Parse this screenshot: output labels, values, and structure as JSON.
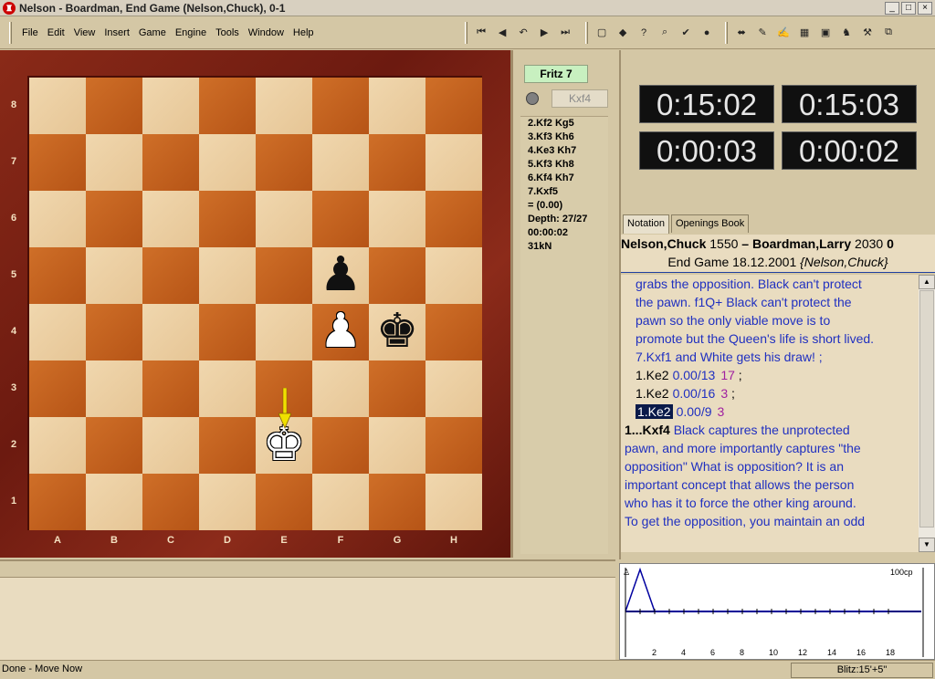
{
  "window": {
    "title": "Nelson - Boardman, End Game  (Nelson,Chuck), 0-1",
    "controls": [
      "_",
      "□",
      "×"
    ]
  },
  "menu": [
    "File",
    "Edit",
    "View",
    "Insert",
    "Game",
    "Engine",
    "Tools",
    "Window",
    "Help"
  ],
  "toolbar": {
    "nav": [
      {
        "icon": "first-move-icon",
        "glyph": "⏮"
      },
      {
        "icon": "prev-move-icon",
        "glyph": "◀"
      },
      {
        "icon": "takeback-icon",
        "glyph": "↶"
      },
      {
        "icon": "next-move-icon",
        "glyph": "▶"
      },
      {
        "icon": "last-move-icon",
        "glyph": "⏭"
      }
    ],
    "tools": [
      {
        "icon": "new-game-icon",
        "glyph": "▢"
      },
      {
        "icon": "hint-icon",
        "glyph": "◆"
      },
      {
        "icon": "question-icon",
        "glyph": "?"
      },
      {
        "icon": "analyze-icon",
        "glyph": "⌕"
      },
      {
        "icon": "ok-icon",
        "glyph": "✔"
      },
      {
        "icon": "stop-icon",
        "glyph": "●"
      }
    ],
    "tools2": [
      {
        "icon": "flip-board-icon",
        "glyph": "⬌"
      },
      {
        "icon": "brush-icon",
        "glyph": "✎"
      },
      {
        "icon": "pen-icon",
        "glyph": "✍"
      },
      {
        "icon": "grid-icon",
        "glyph": "▦"
      },
      {
        "icon": "window-icon",
        "glyph": "▣"
      },
      {
        "icon": "knight-icon",
        "glyph": "♞"
      },
      {
        "icon": "wrench-icon",
        "glyph": "⚒"
      },
      {
        "icon": "windows-icon",
        "glyph": "⧉"
      }
    ]
  },
  "board": {
    "ranks": [
      "8",
      "7",
      "6",
      "5",
      "4",
      "3",
      "2",
      "1"
    ],
    "files": [
      "A",
      "B",
      "C",
      "D",
      "E",
      "F",
      "G",
      "H"
    ],
    "pieces": [
      {
        "square": "f5",
        "glyph": "♟",
        "color": "black",
        "name": "black-pawn-f5"
      },
      {
        "square": "f4",
        "glyph": "♟",
        "color": "white",
        "name": "white-pawn-f4"
      },
      {
        "square": "g4",
        "glyph": "♚",
        "color": "black",
        "name": "black-king-g4"
      },
      {
        "square": "e2",
        "glyph": "♚",
        "color": "white",
        "name": "white-king-e2"
      }
    ]
  },
  "engine": {
    "name": "Fritz 7",
    "current_move": "Kxf4",
    "lines": [
      "2.Kf2 Kg5",
      "3.Kf3 Kh6",
      "4.Ke3 Kh7",
      "5.Kf3 Kh8",
      "6.Kf4 Kh7",
      "7.Kxf5",
      "=  (0.00)",
      "Depth: 27/27",
      "00:00:02",
      "31kN"
    ]
  },
  "clocks": [
    "0:15:02",
    "0:15:03",
    "0:00:03",
    "0:00:02"
  ],
  "notation": {
    "tabs": [
      "Notation",
      "Openings Book"
    ],
    "white_player": "Nelson,Chuck",
    "white_elo": "1550",
    "separator": "–",
    "black_player": "Boardman,Larry",
    "black_elo": "2030",
    "result_partial": "0",
    "event_line": "End Game 18.12.2001",
    "annotator": "{Nelson,Chuck}",
    "comment_lines": [
      "grabs the opposition.  Black can't protect",
      "the pawn.  f1Q+ Black can't protect the",
      "pawn so the only viable move is to",
      "promote but the Queen's life is short lived.",
      "7.Kxf1 and White gets his draw! ;"
    ],
    "variations": [
      {
        "move": "1.Ke2",
        "eval": "0.00/13",
        "num": "17",
        "tail": " ;",
        "selected": false
      },
      {
        "move": "1.Ke2",
        "eval": "0.00/16",
        "num": "3",
        "tail": " ;",
        "selected": false
      },
      {
        "move": "1.Ke2",
        "eval": "0.00/9",
        "num": "3",
        "tail": "",
        "selected": true
      }
    ],
    "main_move": "1...Kxf4",
    "main_lines": [
      " Black captures the unprotected",
      "pawn, and more importantly captures \"the",
      "opposition\"  What is opposition?  It is an",
      "important concept that allows the person",
      "who has it to force the other king around.",
      "To get the opposition, you  maintain an odd"
    ]
  },
  "eval_graph": {
    "max_label": "100cp",
    "x_labels": [
      "2",
      "4",
      "6",
      "8",
      "10",
      "12",
      "14",
      "16",
      "18"
    ],
    "values": [
      0,
      100,
      0,
      0,
      0,
      0,
      0,
      0,
      0,
      0,
      0,
      0,
      0,
      0,
      0,
      0,
      0,
      0,
      0
    ]
  },
  "status": {
    "left": "Done - Move Now",
    "right": "Blitz:15'+5\""
  },
  "colors": {
    "light_square": "#ebcfa4",
    "dark_square": "#c4631f",
    "frame": "#7a1f13",
    "notation_blue": "#2030c0",
    "eval_purple": "#a020a0",
    "engine_green": "#c8f0c0"
  }
}
